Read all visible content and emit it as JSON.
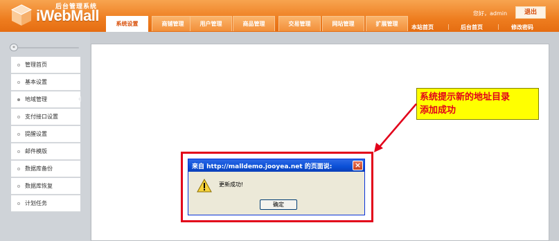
{
  "header": {
    "logo_subtitle": "后台管理系统",
    "logo_title": "iWebMall",
    "greeting": "您好，admin",
    "logout_label": "退出",
    "tabs": [
      {
        "label": "系统设置",
        "active": true
      },
      {
        "label": "商铺管理",
        "active": false
      },
      {
        "label": "用户管理",
        "active": false
      },
      {
        "label": "商品管理",
        "active": false
      },
      {
        "label": "交易管理",
        "active": false
      },
      {
        "label": "网站管理",
        "active": false
      },
      {
        "label": "扩展管理",
        "active": false
      }
    ],
    "links": [
      "本站首页",
      "后台首页",
      "修改密码"
    ],
    "link_separator": "|"
  },
  "sidebar": {
    "collapse_glyph": "«",
    "items": [
      {
        "label": "管理首页",
        "active": false
      },
      {
        "label": "基本设置",
        "active": false
      },
      {
        "label": "地域管理",
        "active": true
      },
      {
        "label": "支付接口设置",
        "active": false
      },
      {
        "label": "提醒设置",
        "active": false
      },
      {
        "label": "邮件模版",
        "active": false
      },
      {
        "label": "数据库备份",
        "active": false
      },
      {
        "label": "数据库恢复",
        "active": false
      },
      {
        "label": "计划任务",
        "active": false
      }
    ]
  },
  "dialog": {
    "title": "来自 http://malldemo.jooyea.net 的页面说:",
    "close_glyph": "×",
    "message": "更新成功!",
    "ok_label": "确定",
    "icon": "warning-icon"
  },
  "annotation": {
    "line1": "系统提示新的地址目录",
    "line2": "添加成功"
  },
  "colors": {
    "header_orange": "#ee7d1f",
    "highlight_red": "#e2001a",
    "annotation_yellow": "#ffff00",
    "dialog_title_blue": "#0a4fd6"
  }
}
